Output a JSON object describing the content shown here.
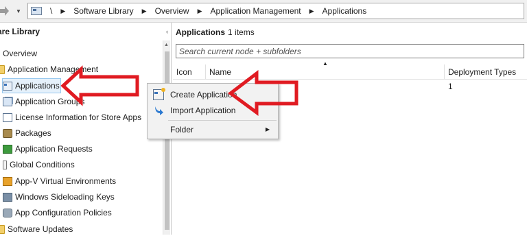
{
  "address_bar": {
    "root": "\\",
    "crumbs": [
      "Software Library",
      "Overview",
      "Application Management",
      "Applications"
    ]
  },
  "left_panel": {
    "title": "are Library",
    "collapse_glyph": "‹",
    "items": [
      {
        "label": "Overview",
        "icon": "overview-icon"
      },
      {
        "label": "Application Management",
        "icon": "folder-icon"
      },
      {
        "label": "Applications",
        "icon": "applications-icon",
        "selected": true
      },
      {
        "label": "Application Groups",
        "icon": "application-groups-icon"
      },
      {
        "label": "License Information for Store Apps",
        "icon": "license-icon"
      },
      {
        "label": "Packages",
        "icon": "packages-icon"
      },
      {
        "label": "Application Requests",
        "icon": "application-requests-icon"
      },
      {
        "label": "Global Conditions",
        "icon": "global-conditions-icon"
      },
      {
        "label": "App-V Virtual Environments",
        "icon": "appv-icon"
      },
      {
        "label": "Windows Sideloading Keys",
        "icon": "sideloading-keys-icon"
      },
      {
        "label": "App Configuration Policies",
        "icon": "config-policies-icon"
      },
      {
        "label": "Software Updates",
        "icon": "folder-icon"
      }
    ]
  },
  "right_panel": {
    "title": "Applications",
    "count": "1 items",
    "search_placeholder": "Search current node + subfolders",
    "columns": [
      "Icon",
      "Name",
      "Deployment Types"
    ],
    "rows": [
      {
        "deployment_types": "1"
      }
    ]
  },
  "context_menu": {
    "items": [
      {
        "label": "Create Application",
        "icon": "create-application-icon"
      },
      {
        "label": "Import Application",
        "icon": "import-arrow-icon"
      },
      {
        "label": "Folder",
        "icon": "",
        "submenu": true
      }
    ]
  },
  "colors": {
    "annotation_red": "#e01b22",
    "selection": "#e5f1fb"
  }
}
